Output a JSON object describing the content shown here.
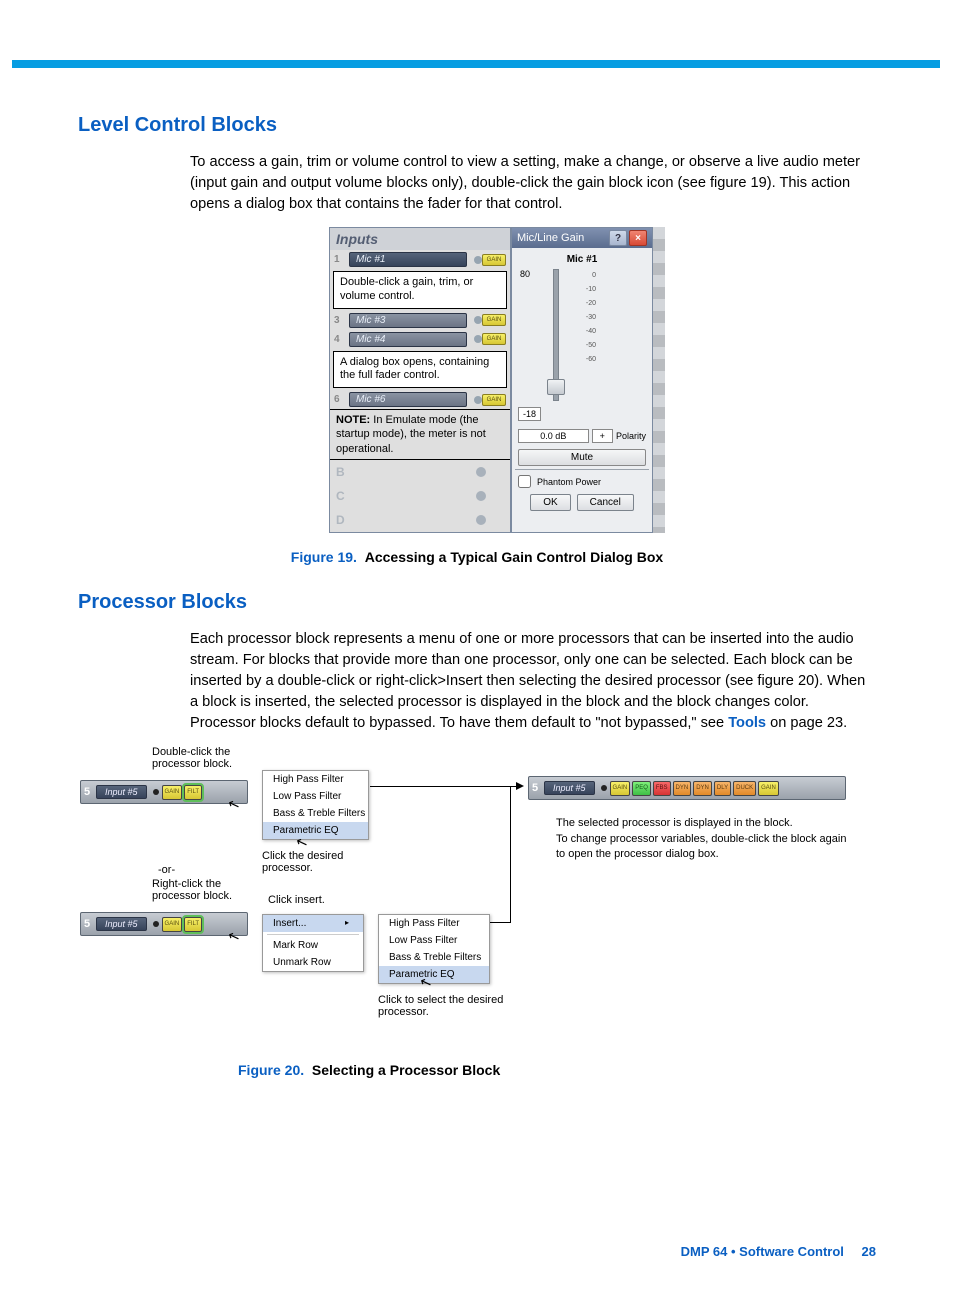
{
  "sec1": {
    "heading": "Level Control Blocks",
    "body": "To access a gain, trim or volume control to view a setting, make a change, or observe a live audio meter (input gain and output volume blocks only), double-click the gain block icon (see figure 19). This action opens a dialog box that contains the fader for that control."
  },
  "fig19": {
    "caption_prefix": "Figure 19.",
    "caption_text": "Accessing a Typical Gain Control Dialog Box",
    "inputs_title": "Inputs",
    "rows": [
      {
        "n": "1",
        "label": "Mic #1"
      },
      {
        "n": "3",
        "label": "Mic #3"
      },
      {
        "n": "4",
        "label": "Mic #4"
      },
      {
        "n": "6",
        "label": "Mic #6"
      }
    ],
    "gain_label": "GAIN",
    "callout1": "Double-click a gain, trim, or volume control.",
    "callout2": "A dialog box opens, containing the full fader control.",
    "note_label": "NOTE:",
    "note_text": "In Emulate mode (the startup mode), the meter is not operational.",
    "gray_rows": [
      "B",
      "C",
      "D"
    ],
    "dialog": {
      "title": "Mic/Line Gain",
      "mic_name": "Mic #1",
      "scale_top": "80",
      "ticks": [
        "0",
        "-10",
        "-20",
        "-30",
        "-40",
        "-50",
        "-60"
      ],
      "readout": "-18",
      "db_value": "0.0 dB",
      "polarity_toggle": "+",
      "polarity_label": "Polarity",
      "mute": "Mute",
      "phantom": "Phantom Power",
      "ok": "OK",
      "cancel": "Cancel"
    }
  },
  "sec2": {
    "heading": "Processor Blocks",
    "body_pre": "Each processor block represents a menu of one or more processors that can be inserted into the audio stream. For blocks that provide more than one processor, only one can be selected. Each block can be inserted by a double-click or right-click>Insert then selecting the desired processor (see figure 20). When a block is inserted, the selected processor is displayed in the block and the block changes color. Processor blocks default to bypassed. To have them default to \"not bypassed,\" see ",
    "link": "Tools",
    "body_post": " on page 23."
  },
  "fig20": {
    "caption_prefix": "Figure 20.",
    "caption_text": "Selecting a Processor Block",
    "label_dbl": "Double-click the processor block.",
    "label_or": "-or-",
    "label_rc": "Right-click the processor block.",
    "label_click_insert": "Click insert.",
    "label_click_proc": "Click the desired processor.",
    "label_click_select": "Click to select the desired processor.",
    "label_selected": "The selected processor is displayed in the block.",
    "label_change": "To change processor variables, double-click the block again to open the processor dialog box.",
    "strip_num": "5",
    "strip_name": "Input #5",
    "blocks_left": [
      "GAIN",
      "FILT"
    ],
    "blocks_right": [
      "GAIN",
      "PEQ",
      "FBS",
      "DYN",
      "DYN",
      "DLY",
      "DUCK",
      "GAIN"
    ],
    "menu_filters": [
      "High Pass Filter",
      "Low Pass Filter",
      "Bass & Treble Filters",
      "Parametric EQ"
    ],
    "menu_ctx": [
      "Insert...",
      "Mark Row",
      "Unmark Row"
    ]
  },
  "footer": {
    "product": "DMP 64 • Software Control",
    "page": "28"
  }
}
